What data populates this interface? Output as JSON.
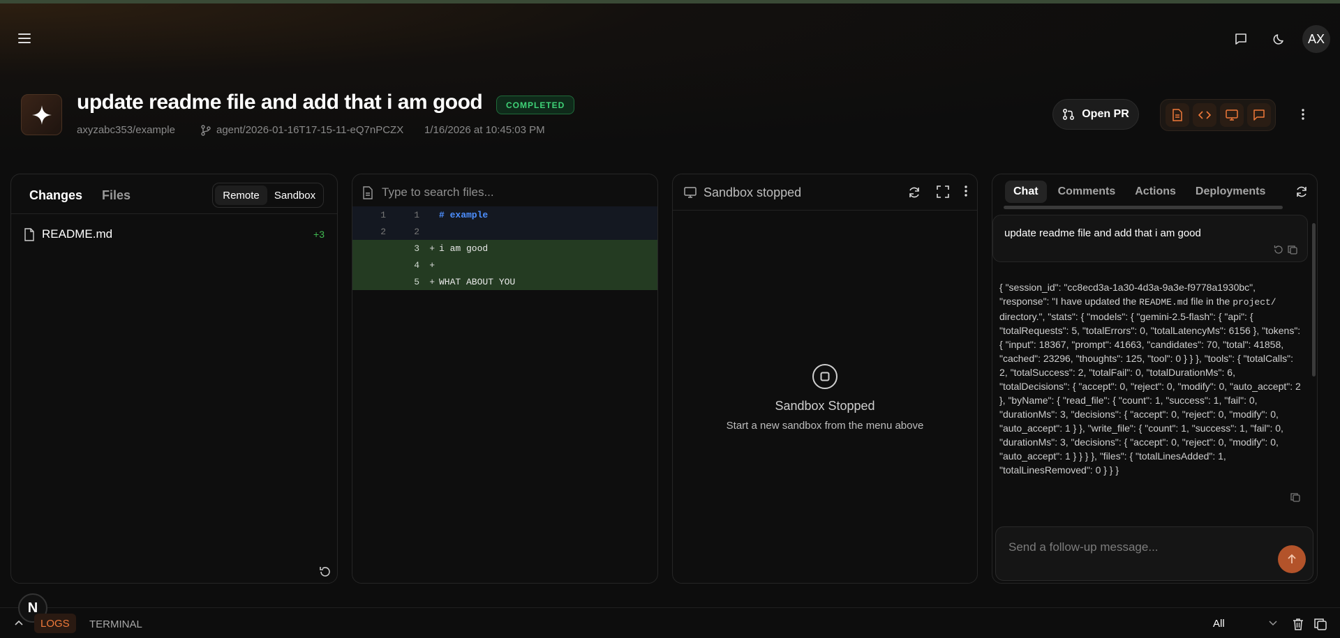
{
  "header": {
    "title": "update readme file and add that i am good",
    "status": "COMPLETED",
    "repo": "axyzabc353/example",
    "branch": "agent/2026-01-16T17-15-11-eQ7nPCZX",
    "timestamp": "1/16/2026 at 10:45:03 PM",
    "open_pr_label": "Open PR",
    "avatar_initials": "AX"
  },
  "changes_panel": {
    "tabs": [
      "Changes",
      "Files"
    ],
    "toggle": [
      "Remote",
      "Sandbox"
    ],
    "files": [
      {
        "name": "README.md",
        "additions": "+3"
      }
    ]
  },
  "diff_panel": {
    "search_placeholder": "Type to search files...",
    "lines": [
      {
        "old": "1",
        "new": "1",
        "marker": "",
        "code": "# example",
        "type": "context"
      },
      {
        "old": "2",
        "new": "2",
        "marker": "",
        "code": "",
        "type": "context"
      },
      {
        "old": "",
        "new": "3",
        "marker": "+",
        "code": "i am good",
        "type": "add"
      },
      {
        "old": "",
        "new": "4",
        "marker": "+",
        "code": "",
        "type": "add"
      },
      {
        "old": "",
        "new": "5",
        "marker": "+",
        "code": "WHAT ABOUT YOU",
        "type": "add"
      }
    ]
  },
  "sandbox_panel": {
    "header": "Sandbox stopped",
    "heading": "Sandbox Stopped",
    "subtext": "Start a new sandbox from the menu above"
  },
  "chat_panel": {
    "tabs": [
      "Chat",
      "Comments",
      "Actions",
      "Deployments"
    ],
    "user_message": "update readme file and add that i am good",
    "response_pre": "{ \"session_id\": \"cc8ecd3a-1a30-4d3a-9a3e-f9778a1930bc\", \"response\": \"I have updated the ",
    "response_code1": "README.md",
    "response_mid": " file in the ",
    "response_code2": "project/",
    "response_post": " directory.\", \"stats\": { \"models\": { \"gemini-2.5-flash\": { \"api\": { \"totalRequests\": 5, \"totalErrors\": 0, \"totalLatencyMs\": 6156 }, \"tokens\": { \"input\": 18367, \"prompt\": 41663, \"candidates\": 70, \"total\": 41858, \"cached\": 23296, \"thoughts\": 125, \"tool\": 0 } } }, \"tools\": { \"totalCalls\": 2, \"totalSuccess\": 2, \"totalFail\": 0, \"totalDurationMs\": 6, \"totalDecisions\": { \"accept\": 0, \"reject\": 0, \"modify\": 0, \"auto_accept\": 2 }, \"byName\": { \"read_file\": { \"count\": 1, \"success\": 1, \"fail\": 0, \"durationMs\": 3, \"decisions\": { \"accept\": 0, \"reject\": 0, \"modify\": 0, \"auto_accept\": 1 } }, \"write_file\": { \"count\": 1, \"success\": 1, \"fail\": 0, \"durationMs\": 3, \"decisions\": { \"accept\": 0, \"reject\": 0, \"modify\": 0, \"auto_accept\": 1 } } } }, \"files\": { \"totalLinesAdded\": 1, \"totalLinesRemoved\": 0 } } }",
    "input_placeholder": "Send a follow-up message..."
  },
  "bottom_bar": {
    "logo_letter": "N",
    "logs_label": "LOGS",
    "terminal_label": "TERMINAL",
    "filter_value": "All"
  },
  "colors": {
    "accent": "#f07a3a",
    "success": "#3fd277",
    "diff_add_bg": "#243b22"
  }
}
